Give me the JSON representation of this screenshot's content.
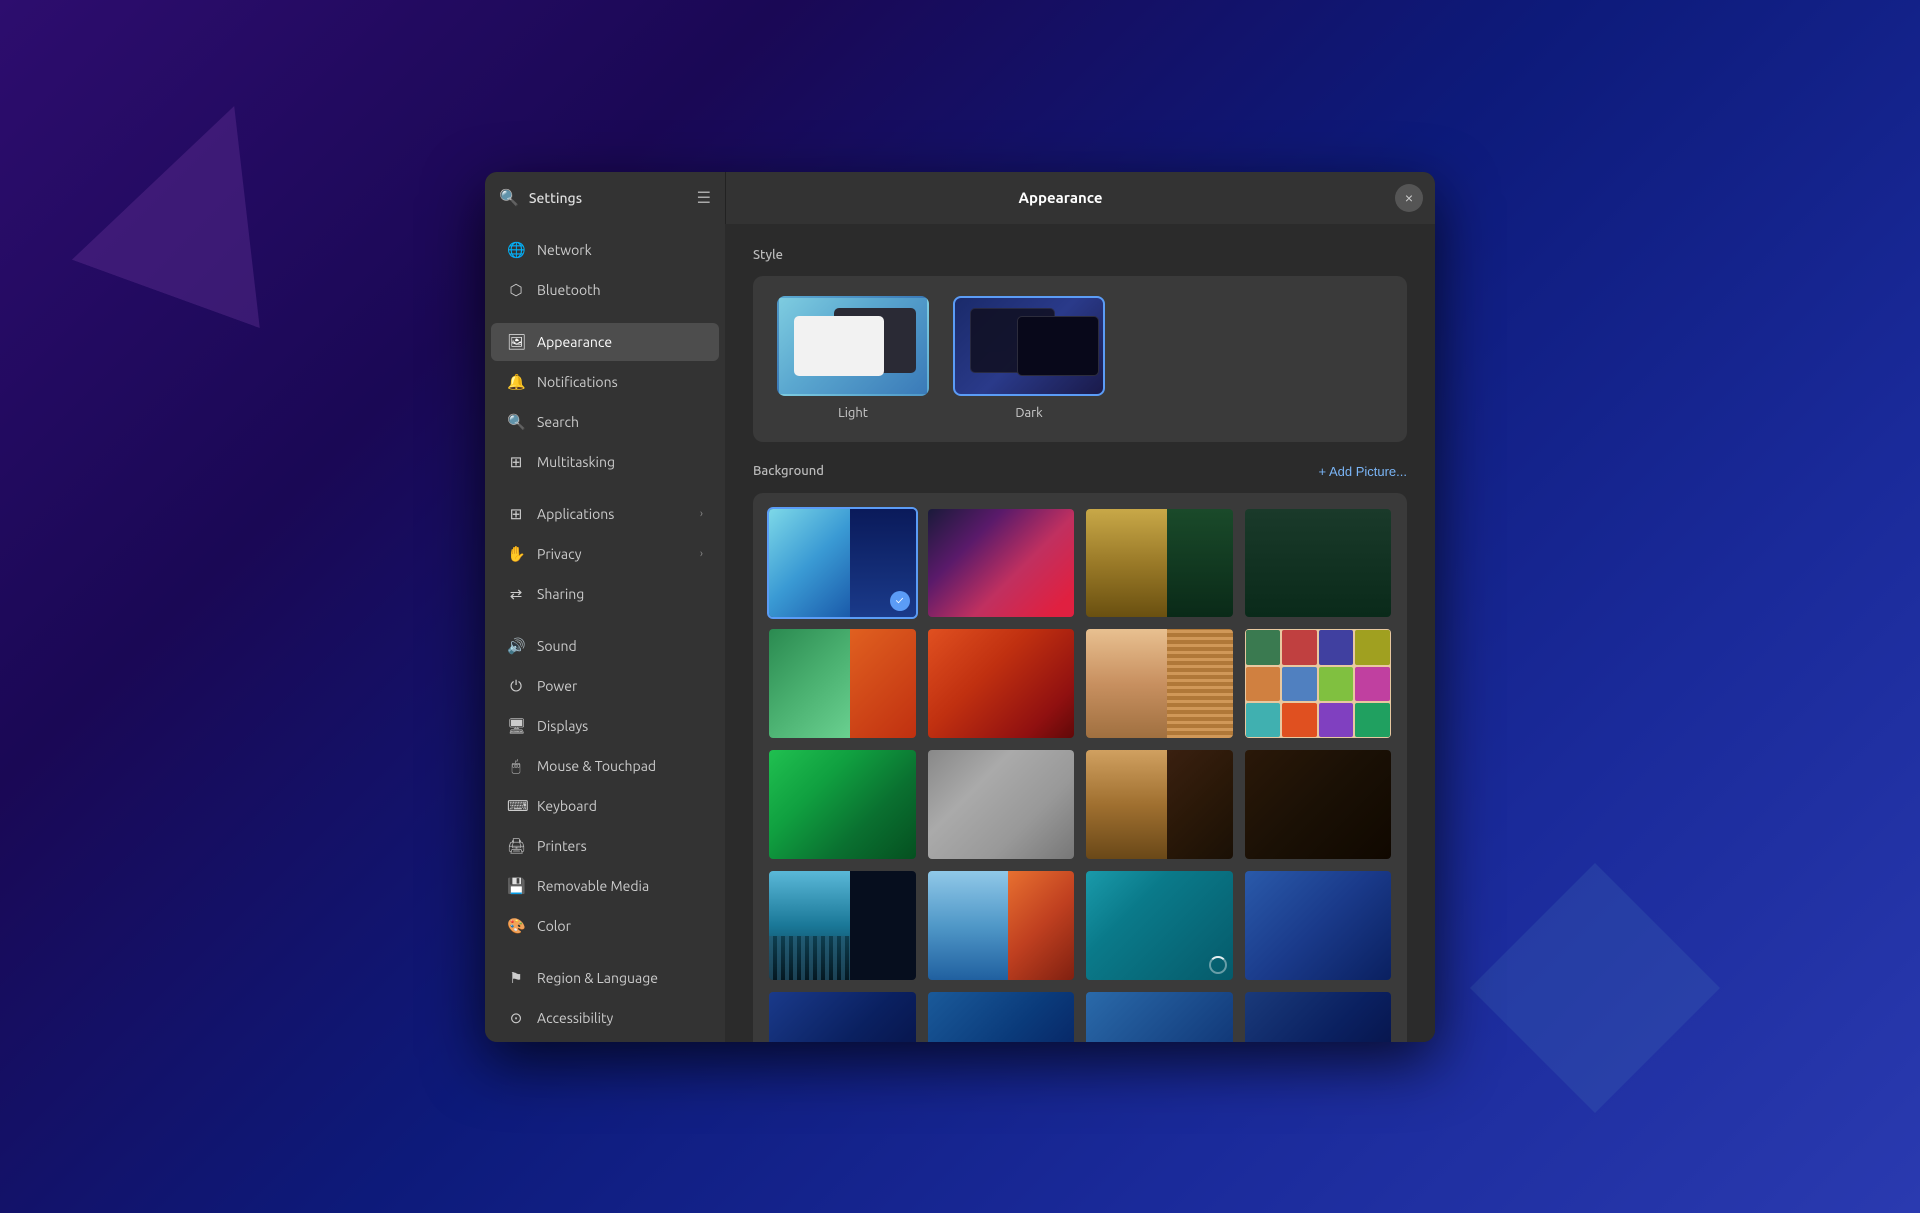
{
  "window": {
    "title_settings": "Settings",
    "title_main": "Appearance",
    "close_label": "×"
  },
  "sidebar": {
    "items": [
      {
        "id": "network",
        "label": "Network",
        "icon": "🌐"
      },
      {
        "id": "bluetooth",
        "label": "Bluetooth",
        "icon": "⬡"
      },
      {
        "id": "appearance",
        "label": "Appearance",
        "icon": "🖼",
        "active": true
      },
      {
        "id": "notifications",
        "label": "Notifications",
        "icon": "🔔"
      },
      {
        "id": "search",
        "label": "Search",
        "icon": "🔍"
      },
      {
        "id": "multitasking",
        "label": "Multitasking",
        "icon": "⊞"
      },
      {
        "id": "applications",
        "label": "Applications",
        "icon": "⊞",
        "has_chevron": true
      },
      {
        "id": "privacy",
        "label": "Privacy",
        "icon": "✋",
        "has_chevron": true
      },
      {
        "id": "sharing",
        "label": "Sharing",
        "icon": "⇄"
      },
      {
        "id": "sound",
        "label": "Sound",
        "icon": "🔊"
      },
      {
        "id": "power",
        "label": "Power",
        "icon": "⏻"
      },
      {
        "id": "displays",
        "label": "Displays",
        "icon": "🖥"
      },
      {
        "id": "mouse",
        "label": "Mouse & Touchpad",
        "icon": "🖱"
      },
      {
        "id": "keyboard",
        "label": "Keyboard",
        "icon": "⌨"
      },
      {
        "id": "printers",
        "label": "Printers",
        "icon": "🖨"
      },
      {
        "id": "removable",
        "label": "Removable Media",
        "icon": "💾"
      },
      {
        "id": "color",
        "label": "Color",
        "icon": "🎨"
      },
      {
        "id": "region",
        "label": "Region & Language",
        "icon": "⚑"
      },
      {
        "id": "accessibility",
        "label": "Accessibility",
        "icon": "⊙"
      }
    ]
  },
  "appearance": {
    "style_section_title": "Style",
    "style_options": [
      {
        "id": "light",
        "label": "Light",
        "selected": false
      },
      {
        "id": "dark",
        "label": "Dark",
        "selected": true
      }
    ],
    "background_section_title": "Background",
    "add_picture_label": "+ Add Picture...",
    "wallpapers": [
      {
        "id": "wp1",
        "selected": true,
        "type": "split"
      },
      {
        "id": "wp2",
        "selected": false,
        "type": "gradient"
      },
      {
        "id": "wp3",
        "selected": false,
        "type": "split"
      },
      {
        "id": "wp4",
        "selected": false,
        "type": "dark"
      },
      {
        "id": "wp5",
        "selected": false,
        "type": "gradient"
      },
      {
        "id": "wp6",
        "selected": false,
        "type": "gradient"
      },
      {
        "id": "wp7",
        "selected": false,
        "type": "split"
      },
      {
        "id": "wp8",
        "selected": false,
        "type": "collage"
      },
      {
        "id": "wp9",
        "selected": false,
        "type": "gradient"
      },
      {
        "id": "wp10",
        "selected": false,
        "type": "gradient"
      },
      {
        "id": "wp11",
        "selected": false,
        "type": "split"
      },
      {
        "id": "wp12",
        "selected": false,
        "type": "dark"
      },
      {
        "id": "wp13",
        "selected": false,
        "type": "split"
      },
      {
        "id": "wp14",
        "selected": false,
        "type": "split"
      },
      {
        "id": "wp15",
        "selected": false,
        "type": "loading"
      },
      {
        "id": "wp16",
        "selected": false,
        "type": "gradient"
      },
      {
        "id": "wp17",
        "selected": false,
        "type": "gradient"
      },
      {
        "id": "wp18",
        "selected": false,
        "type": "gradient"
      }
    ]
  }
}
